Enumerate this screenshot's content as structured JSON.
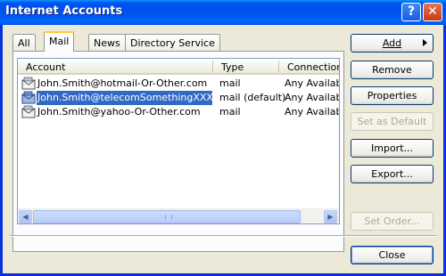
{
  "window": {
    "title": "Internet Accounts",
    "help_glyph": "?",
    "close_glyph": "✕"
  },
  "tabs": [
    {
      "label": "All",
      "active": false
    },
    {
      "label": "Mail",
      "active": true
    },
    {
      "label": "News",
      "active": false
    },
    {
      "label": "Directory Service",
      "active": false
    }
  ],
  "list": {
    "columns": [
      "Account",
      "Type",
      "Connection"
    ],
    "rows": [
      {
        "account": "John.Smith@hotmail-Or-Other.com",
        "type": "mail",
        "connection": "Any Available",
        "selected": false
      },
      {
        "account": "John.Smith@telecomSomethingXXX.com",
        "type": "mail (default)",
        "connection": "Any Available",
        "selected": true
      },
      {
        "account": "John.Smith@yahoo-Or-Other.com",
        "type": "mail",
        "connection": "Any Available",
        "selected": false
      }
    ]
  },
  "buttons": {
    "add": "Add",
    "remove": "Remove",
    "properties": "Properties",
    "set_default": "Set as Default",
    "import": "Import...",
    "export": "Export...",
    "set_order": "Set Order...",
    "close": "Close"
  },
  "scrollbar": {
    "left_glyph": "◀",
    "right_glyph": "▶"
  },
  "colors": {
    "titlebar": "#0053ee",
    "selection": "#316ac5",
    "window_bg": "#ece9d8"
  }
}
